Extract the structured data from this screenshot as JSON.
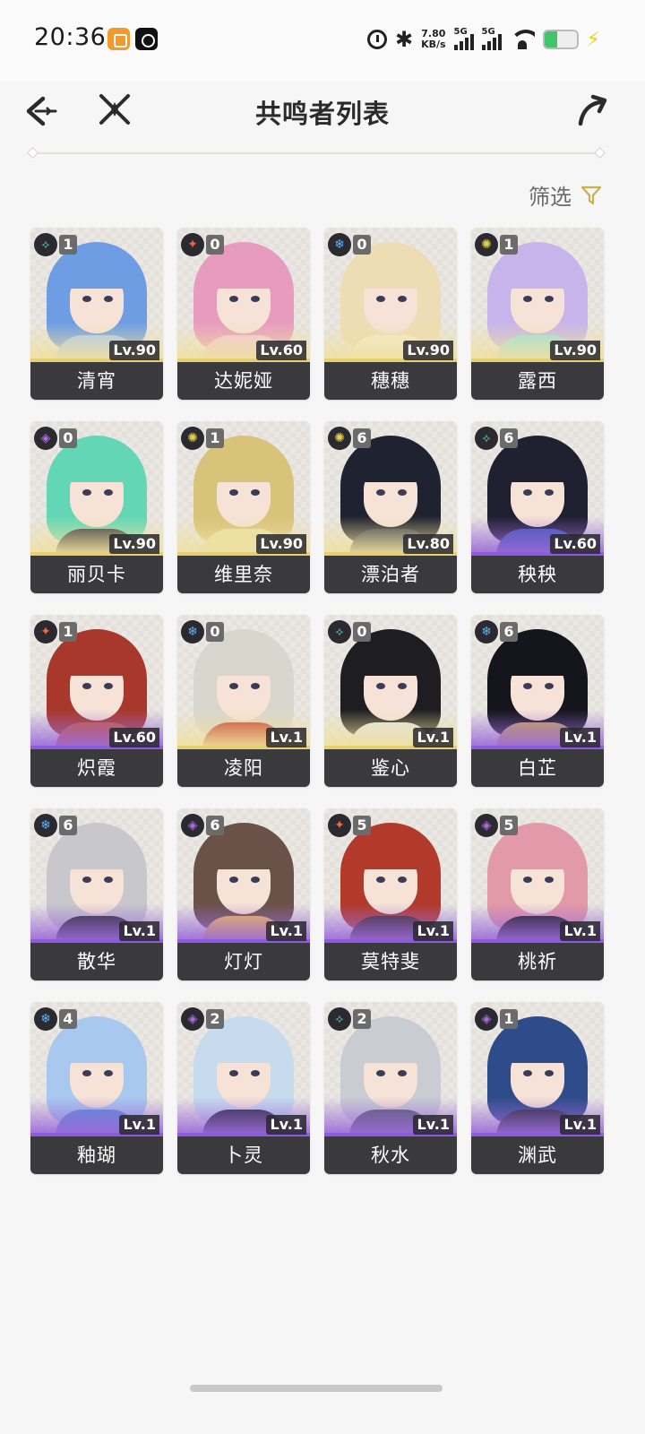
{
  "status_bar": {
    "time": "20:36",
    "net_speed_value": "7.80",
    "net_speed_unit": "KB/s",
    "signal_1_label": "5G",
    "signal_2_label": "5G",
    "battery_level": 0.4,
    "icons": [
      "orange-app-icon",
      "tiktok-icon",
      "alarm-icon",
      "bluetooth-icon",
      "signal-icon",
      "wifi-icon",
      "battery-icon",
      "charging-icon"
    ]
  },
  "header": {
    "title": "共鸣者列表",
    "back_icon": "back-arrow-icon",
    "emblem_icon": "crossed-emblem-icon",
    "share_icon": "share-arrow-icon"
  },
  "filter": {
    "label": "筛选",
    "icon": "filter-icon",
    "accent": "#c9b04a"
  },
  "colors": {
    "rarity_5": "#e6cf73",
    "rarity_4": "#8e5be0",
    "name_bar": "#3a3a3c",
    "element_aero": "#5fd69a",
    "element_fusion": "#f0653a",
    "element_glacio": "#5fb0f5",
    "element_spectro": "#e6d14a",
    "element_havoc": "#b36ae8",
    "element_electro": "#c25fd6"
  },
  "characters": [
    {
      "name": "清宵",
      "sequence": "1",
      "level": "Lv.90",
      "element": "aero",
      "element_icon": "aero-icon",
      "rarity": 5,
      "hair": "#6f9de3",
      "accent": "#a9c9f5"
    },
    {
      "name": "达妮娅",
      "sequence": "0",
      "level": "Lv.60",
      "element": "fusion",
      "element_icon": "fusion-icon",
      "rarity": 5,
      "hair": "#e79cbf",
      "accent": "#f3c6da"
    },
    {
      "name": "穗穗",
      "sequence": "0",
      "level": "Lv.90",
      "element": "glacio",
      "element_icon": "glacio-icon",
      "rarity": 5,
      "hair": "#eedcb4",
      "accent": "#f6ebd0"
    },
    {
      "name": "露西",
      "sequence": "1",
      "level": "Lv.90",
      "element": "spectro",
      "element_icon": "spectro-icon",
      "rarity": 5,
      "hair": "#c7b4ea",
      "accent": "#9be0de"
    },
    {
      "name": "丽贝卡",
      "sequence": "0",
      "level": "Lv.90",
      "element": "havoc",
      "element_icon": "havoc-icon",
      "rarity": 5,
      "hair": "#63d6b6",
      "accent": "#2f2f3a"
    },
    {
      "name": "维里奈",
      "sequence": "1",
      "level": "Lv.90",
      "element": "spectro",
      "element_icon": "spectro-icon",
      "rarity": 5,
      "hair": "#d9c27a",
      "accent": "#ece0a3"
    },
    {
      "name": "漂泊者",
      "sequence": "6",
      "level": "Lv.80",
      "element": "spectro",
      "element_icon": "spectro-icon",
      "rarity": 5,
      "hair": "#1f2230",
      "accent": "#3b3e50"
    },
    {
      "name": "秧秧",
      "sequence": "6",
      "level": "Lv.60",
      "element": "aero",
      "element_icon": "aero-icon",
      "rarity": 4,
      "hair": "#1f2030",
      "accent": "#3a59b8"
    },
    {
      "name": "炽霞",
      "sequence": "1",
      "level": "Lv.60",
      "element": "fusion",
      "element_icon": "fusion-icon",
      "rarity": 4,
      "hair": "#a8382b",
      "accent": "#c95a3c"
    },
    {
      "name": "凌阳",
      "sequence": "0",
      "level": "Lv.1",
      "element": "glacio",
      "element_icon": "glacio-icon",
      "rarity": 5,
      "hair": "#d8d6cc",
      "accent": "#c4412f"
    },
    {
      "name": "鉴心",
      "sequence": "0",
      "level": "Lv.1",
      "element": "aero",
      "element_icon": "aero-icon",
      "rarity": 5,
      "hair": "#1e1e22",
      "accent": "#e2e2e2"
    },
    {
      "name": "白芷",
      "sequence": "6",
      "level": "Lv.1",
      "element": "glacio",
      "element_icon": "glacio-icon",
      "rarity": 4,
      "hair": "#15161d",
      "accent": "#c9a85a"
    },
    {
      "name": "散华",
      "sequence": "6",
      "level": "Lv.1",
      "element": "glacio",
      "element_icon": "glacio-icon",
      "rarity": 4,
      "hair": "#c7c7cc",
      "accent": "#2e2e34"
    },
    {
      "name": "灯灯",
      "sequence": "6",
      "level": "Lv.1",
      "element": "havoc",
      "element_icon": "havoc-icon",
      "rarity": 4,
      "hair": "#6b5248",
      "accent": "#f3c14f"
    },
    {
      "name": "莫特斐",
      "sequence": "5",
      "level": "Lv.1",
      "element": "fusion",
      "element_icon": "fusion-icon",
      "rarity": 4,
      "hair": "#b23a2a",
      "accent": "#3d2c2c"
    },
    {
      "name": "桃祈",
      "sequence": "5",
      "level": "Lv.1",
      "element": "havoc",
      "element_icon": "havoc-icon",
      "rarity": 4,
      "hair": "#e39aa8",
      "accent": "#1e1e22"
    },
    {
      "name": "釉瑚",
      "sequence": "4",
      "level": "Lv.1",
      "element": "glacio",
      "element_icon": "glacio-icon",
      "rarity": 4,
      "hair": "#a8c8ef",
      "accent": "#5a8fd6"
    },
    {
      "name": "卜灵",
      "sequence": "2",
      "level": "Lv.1",
      "element": "havoc",
      "element_icon": "havoc-icon",
      "rarity": 4,
      "hair": "#c7dbee",
      "accent": "#2c2c3c"
    },
    {
      "name": "秋水",
      "sequence": "2",
      "level": "Lv.1",
      "element": "aero",
      "element_icon": "aero-icon",
      "rarity": 4,
      "hair": "#c9ccd2",
      "accent": "#5a5f70"
    },
    {
      "name": "渊武",
      "sequence": "1",
      "level": "Lv.1",
      "element": "havoc",
      "element_icon": "havoc-icon",
      "rarity": 4,
      "hair": "#2f4c8a",
      "accent": "#2a2a36"
    }
  ]
}
